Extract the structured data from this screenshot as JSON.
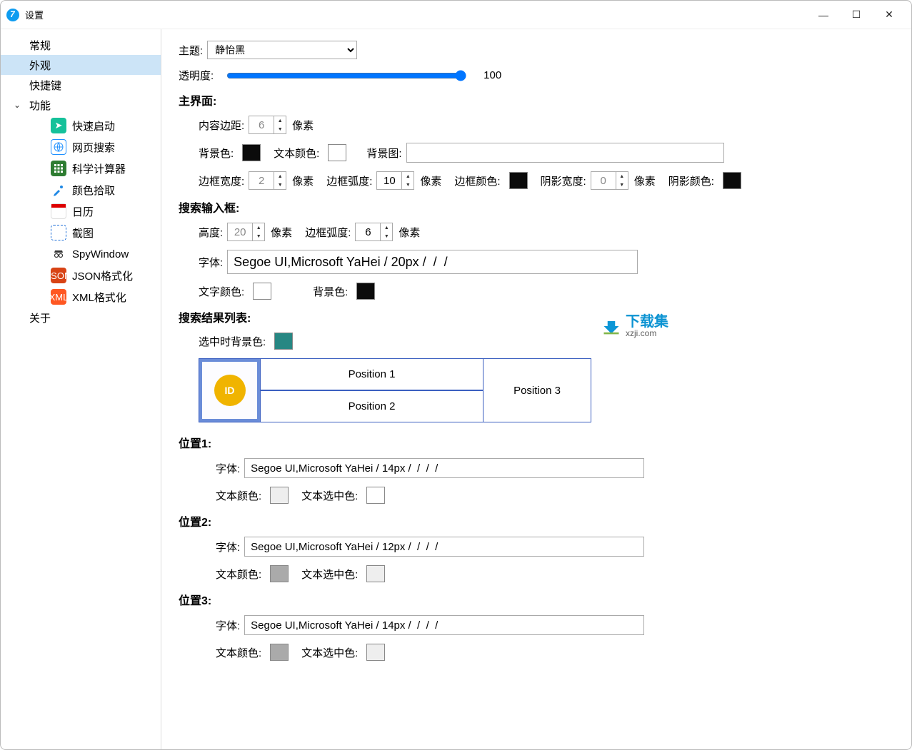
{
  "window": {
    "title": "设置"
  },
  "winbuttons": {
    "min": "—",
    "max": "☐",
    "close": "✕"
  },
  "sidebar": {
    "general": "常规",
    "appearance": "外观",
    "shortcuts": "快捷键",
    "features": "功能",
    "about": "关于",
    "subs": {
      "quicklaunch": "快速启动",
      "websearch": "网页搜索",
      "calculator": "科学计算器",
      "colorpicker": "颜色拾取",
      "calendar": "日历",
      "screenshot": "截图",
      "spywindow": "SpyWindow",
      "jsonfmt": "JSON格式化",
      "xmlfmt": "XML格式化"
    }
  },
  "theme": {
    "label": "主题:",
    "value": "静怡黑"
  },
  "opacity": {
    "label": "透明度:",
    "value": "100"
  },
  "mainui": {
    "title": "主界面:",
    "padding_label": "内容边距:",
    "padding_value": "6",
    "unit_px": "像素",
    "bg_label": "背景色:",
    "text_color_label": "文本颜色:",
    "bg_img_label": "背景图:",
    "bg_img_value": "",
    "border_w_label": "边框宽度:",
    "border_w_value": "2",
    "border_r_label": "边框弧度:",
    "border_r_value": "10",
    "border_c_label": "边框颜色:",
    "shadow_w_label": "阴影宽度:",
    "shadow_w_value": "0",
    "shadow_c_label": "阴影颜色:"
  },
  "searchbox": {
    "title": "搜索输入框:",
    "height_label": "高度:",
    "height_value": "20",
    "radius_label": "边框弧度:",
    "radius_value": "6",
    "font_label": "字体:",
    "font_value": "Segoe UI,Microsoft YaHei / 20px /  /  /",
    "text_color_label": "文字颜色:",
    "bg_label": "背景色:"
  },
  "results": {
    "title": "搜索结果列表:",
    "selbg_label": "选中时背景色:",
    "diagram": {
      "id": "ID",
      "p1": "Position 1",
      "p2": "Position 2",
      "p3": "Position 3"
    }
  },
  "pos1": {
    "title": "位置1:",
    "font_label": "字体:",
    "font_value": "Segoe UI,Microsoft YaHei / 14px /  /  /  /",
    "text_color_label": "文本颜色:",
    "sel_color_label": "文本选中色:"
  },
  "pos2": {
    "title": "位置2:",
    "font_label": "字体:",
    "font_value": "Segoe UI,Microsoft YaHei / 12px /  /  /  /",
    "text_color_label": "文本颜色:",
    "sel_color_label": "文本选中色:"
  },
  "pos3": {
    "title": "位置3:",
    "font_label": "字体:",
    "font_value": "Segoe UI,Microsoft YaHei / 14px /  /  /  /",
    "text_color_label": "文本颜色:",
    "sel_color_label": "文本选中色:"
  },
  "watermark": {
    "line1": "下载集",
    "line2": "xzji.com"
  }
}
